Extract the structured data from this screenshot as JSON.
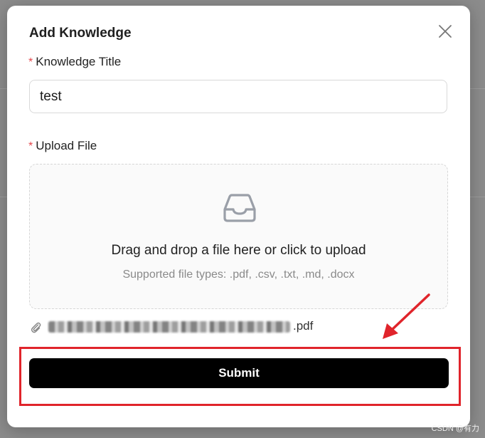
{
  "dialog": {
    "title": "Add Knowledge"
  },
  "form": {
    "required_mark": "*",
    "title_label": "Knowledge Title",
    "title_value": "test",
    "file_label": "Upload File"
  },
  "dropzone": {
    "icon": "inbox-icon",
    "main_text": "Drag and drop a file here or click to upload",
    "sub_text": "Supported file types: .pdf, .csv, .txt, .md, .docx"
  },
  "file": {
    "icon": "paperclip-icon",
    "extension": ".pdf"
  },
  "actions": {
    "submit_label": "Submit"
  },
  "annotation": {
    "color": "#e0242b"
  },
  "watermark": {
    "text": "CSDN @有力"
  },
  "colors": {
    "primary_button": "#000000",
    "required": "#e5484d"
  }
}
